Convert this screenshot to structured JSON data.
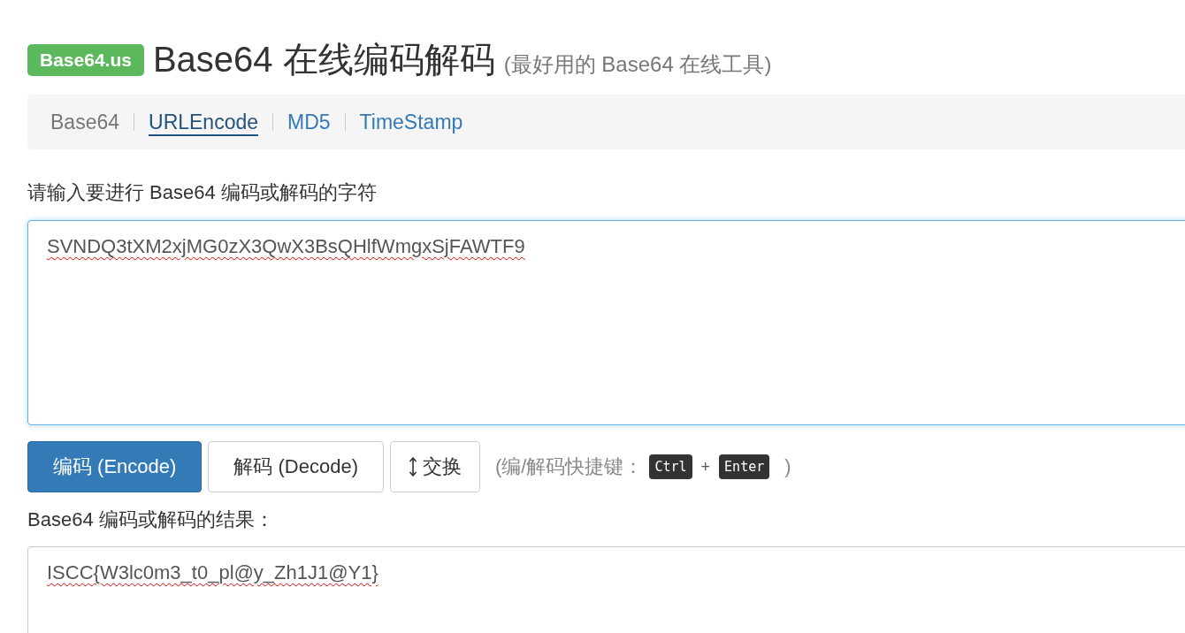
{
  "header": {
    "badge": "Base64.us",
    "title": "Base64 在线编码解码",
    "subtitle": "(最好用的 Base64 在线工具)"
  },
  "nav": [
    {
      "label": "Base64",
      "selected": true,
      "hovered": false
    },
    {
      "label": "URLEncode",
      "selected": false,
      "hovered": true
    },
    {
      "label": "MD5",
      "selected": false,
      "hovered": false
    },
    {
      "label": "TimeStamp",
      "selected": false,
      "hovered": false
    }
  ],
  "input": {
    "label": "请输入要进行 Base64 编码或解码的字符",
    "value": "SVNDQ3tXM2xjMG0zX3QwX3BsQHlfWmgxSjFAWTF9",
    "focused": true,
    "misspelled": true
  },
  "buttons": [
    {
      "kind": "primary",
      "label": "编码 (Encode)"
    },
    {
      "kind": "default",
      "label": "解码 (Decode)"
    },
    {
      "kind": "swap",
      "label": "交换"
    }
  ],
  "shortcut": {
    "prefix": "(编/解码快捷键：",
    "keys": [
      "Ctrl",
      "Enter"
    ],
    "joiner": "+",
    "suffix": ")"
  },
  "output": {
    "label": "Base64 编码或解码的结果：",
    "value": "ISCC{W3lc0m3_t0_pl@y_Zh1J1@Y1}",
    "focused": false,
    "misspelled": true
  }
}
